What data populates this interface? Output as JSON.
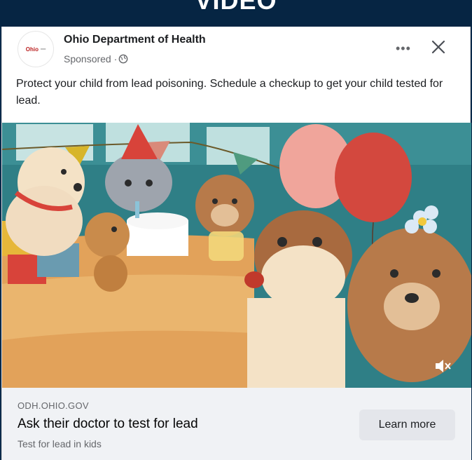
{
  "banner": {
    "title": "VIDEO"
  },
  "ad": {
    "advertiser": "Ohio Department of Health",
    "avatar_text": "Ohio",
    "sponsored": "Sponsored ·",
    "message": "Protect your child from lead poisoning. Schedule a checkup to get your child tested for lead.",
    "link": {
      "domain": "ODH.OHIO.GOV",
      "headline": "Ask their doctor to test for lead",
      "description": "Test for lead in kids",
      "cta_label": "Learn more"
    },
    "icons": {
      "globe": "globe-icon",
      "more": "more-options-icon",
      "close": "close-icon",
      "mute": "speaker-muted-icon"
    },
    "colors": {
      "banner": "#062543",
      "footer": "#f0f2f5",
      "cta": "#e4e6eb"
    }
  }
}
